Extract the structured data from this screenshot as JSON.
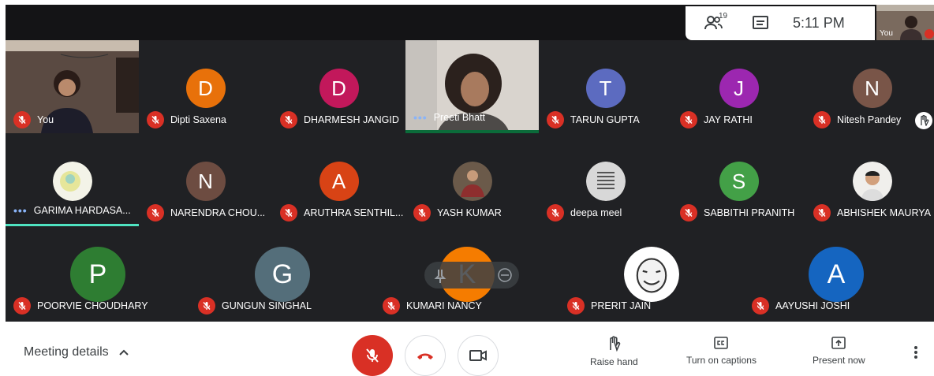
{
  "topbar": {
    "participant_count": "19",
    "time": "5:11 PM",
    "self_label": "You"
  },
  "colors": {
    "mic_off_red": "#d93025",
    "tile_bg": "#202124",
    "speaking_accent": "#4fe3c1"
  },
  "participants": [
    {
      "name": "You",
      "type": "video"
    },
    {
      "name": "Dipti Saxena",
      "initial": "D",
      "color": "#e8710a"
    },
    {
      "name": "DHARMESH JANGID",
      "initial": "D",
      "color": "#c2185b"
    },
    {
      "name": "Preeti Bhatt",
      "type": "video"
    },
    {
      "name": "TARUN GUPTA",
      "initial": "T",
      "color": "#5c6bc0"
    },
    {
      "name": "JAY RATHI",
      "initial": "J",
      "color": "#9c27b0"
    },
    {
      "name": "Nitesh Pandey",
      "initial": "N",
      "color": "#795548"
    },
    {
      "name": "GARIMA HARDASA...",
      "type": "photo"
    },
    {
      "name": "NARENDRA CHOU...",
      "initial": "N",
      "color": "#6d4c41"
    },
    {
      "name": "ARUTHRA SENTHIL...",
      "initial": "A",
      "color": "#d84315"
    },
    {
      "name": "YASH KUMAR",
      "type": "photo"
    },
    {
      "name": "deepa meel",
      "type": "photo"
    },
    {
      "name": "SABBITHI PRANITH",
      "initial": "S",
      "color": "#43a047"
    },
    {
      "name": "ABHISHEK MAURYA",
      "type": "photo"
    },
    {
      "name": "POORVIE CHOUDHARY",
      "initial": "P",
      "color": "#2e7d32"
    },
    {
      "name": "GUNGUN SINGHAL",
      "initial": "G",
      "color": "#546e7a"
    },
    {
      "name": "KUMARI NANCY",
      "initial": "K",
      "color": "#f57c00"
    },
    {
      "name": "PRERIT JAIN",
      "type": "photo"
    },
    {
      "name": "AAYUSHI JOSHI",
      "initial": "A",
      "color": "#1565c0"
    }
  ],
  "bottombar": {
    "meeting_details": "Meeting details",
    "raise_hand": "Raise hand",
    "captions": "Turn on captions",
    "present": "Present now"
  }
}
